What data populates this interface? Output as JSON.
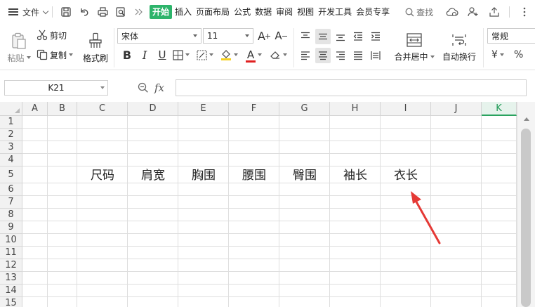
{
  "menubar": {
    "file_label": "文件",
    "tabs": [
      "开始",
      "插入",
      "页面布局",
      "公式",
      "数据",
      "审阅",
      "视图",
      "开发工具",
      "会员专享"
    ],
    "active_tab": "开始",
    "search_label": "查找",
    "accent_color": "#2db46b"
  },
  "ribbon": {
    "paste_label": "粘贴",
    "cut_label": "剪切",
    "copy_label": "复制",
    "format_painter_label": "格式刷",
    "font_name": "宋体",
    "font_size": "11",
    "bold_label": "B",
    "italic_label": "I",
    "underline_label": "U",
    "grow_font_label": "A",
    "shrink_font_label": "A",
    "font_color_label": "A",
    "merge_center_label": "合并居中",
    "wrap_text_label": "自动换行",
    "number_format": "常规",
    "currency_label": "¥",
    "percent_label": "%",
    "font_color_hex": "#e02020",
    "fill_color_hex": "#f5d020"
  },
  "formula_bar": {
    "cell_ref": "K21",
    "fx_label": "fx",
    "formula_value": ""
  },
  "sheet": {
    "columns": [
      "A",
      "B",
      "C",
      "D",
      "E",
      "F",
      "G",
      "H",
      "I",
      "J",
      "K"
    ],
    "selected_column": "K",
    "rows": [
      "1",
      "2",
      "3",
      "4",
      "5",
      "6",
      "7",
      "8",
      "9",
      "10",
      "11",
      "12",
      "13",
      "14",
      "15"
    ],
    "row5_values": [
      "尺码",
      "肩宽",
      "胸围",
      "腰围",
      "臀围",
      "袖长",
      "衣长"
    ],
    "annotation_color": "#e53935"
  }
}
